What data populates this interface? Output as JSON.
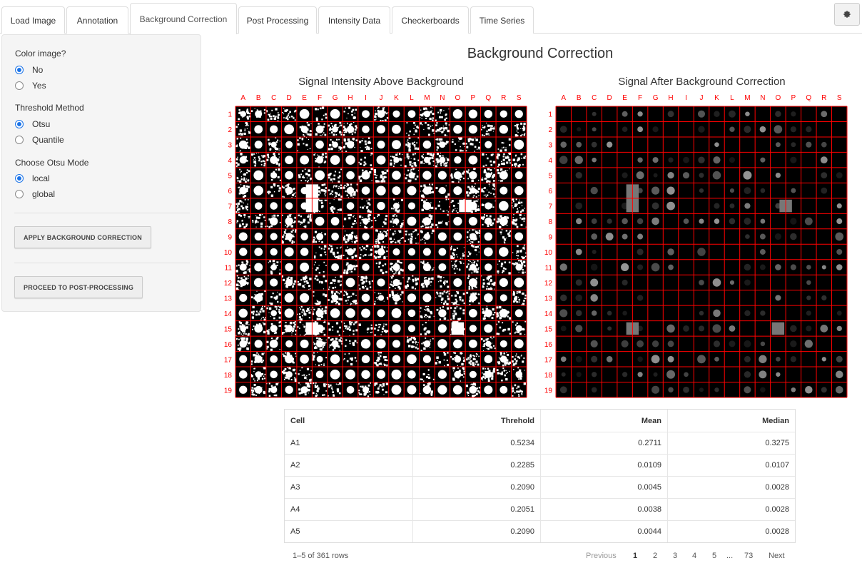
{
  "tabs": [
    {
      "label": "Load Image"
    },
    {
      "label": "Annotation"
    },
    {
      "label": "Background Correction"
    },
    {
      "label": "Post Processing"
    },
    {
      "label": "Intensity Data"
    },
    {
      "label": "Checkerboards"
    },
    {
      "label": "Time Series"
    }
  ],
  "active_tab": "Background Correction",
  "settings_icon": "gear-icon",
  "sidebar": {
    "color_image": {
      "label": "Color image?",
      "options": [
        "No",
        "Yes"
      ],
      "selected": "No"
    },
    "threshold_method": {
      "label": "Threshold Method",
      "options": [
        "Otsu",
        "Quantile"
      ],
      "selected": "Otsu"
    },
    "otsu_mode": {
      "label": "Choose Otsu Mode",
      "options": [
        "local",
        "global"
      ],
      "selected": "local"
    },
    "apply_button": "APPLY BACKGROUND CORRECTION",
    "proceed_button": "PROCEED TO POST-PROCESSING"
  },
  "main": {
    "title": "Background Correction",
    "plot_left_title": "Signal Intensity Above Background",
    "plot_right_title": "Signal After Background Correction",
    "grid": {
      "columns": [
        "A",
        "B",
        "C",
        "D",
        "E",
        "F",
        "G",
        "H",
        "I",
        "J",
        "K",
        "L",
        "M",
        "N",
        "O",
        "P",
        "Q",
        "R",
        "S"
      ],
      "rows": [
        "1",
        "2",
        "3",
        "4",
        "5",
        "6",
        "7",
        "8",
        "9",
        "10",
        "11",
        "12",
        "13",
        "14",
        "15",
        "16",
        "17",
        "18",
        "19"
      ],
      "label_color": "#ff0000",
      "grid_color": "#ff0000"
    }
  },
  "table": {
    "headers": [
      "Cell",
      "Threhold",
      "Mean",
      "Median"
    ],
    "rows": [
      [
        "A1",
        "0.5234",
        "0.2711",
        "0.3275"
      ],
      [
        "A2",
        "0.2285",
        "0.0109",
        "0.0107"
      ],
      [
        "A3",
        "0.2090",
        "0.0045",
        "0.0028"
      ],
      [
        "A4",
        "0.2051",
        "0.0038",
        "0.0028"
      ],
      [
        "A5",
        "0.2090",
        "0.0044",
        "0.0028"
      ]
    ],
    "row_count": "1–5 of 361 rows",
    "pagination": {
      "previous": "Previous",
      "pages": [
        "1",
        "2",
        "3",
        "4",
        "5"
      ],
      "ellipsis": "...",
      "last": "73",
      "next": "Next",
      "current": "1"
    }
  },
  "colors": {
    "accent": "#1a73e8",
    "grid_red": "#ff0000"
  }
}
